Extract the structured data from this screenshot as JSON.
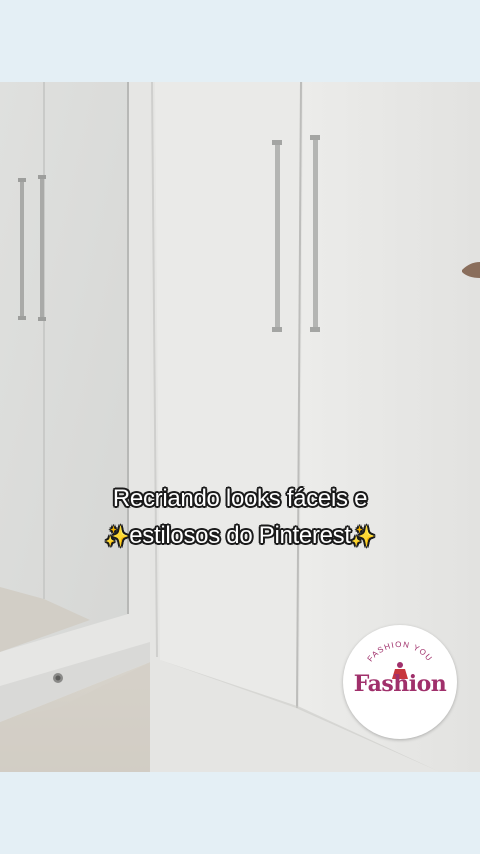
{
  "caption": {
    "line1": "Recriando looks fáceis e",
    "line2": "estilosos do Pinterest",
    "sparkle": "✨"
  },
  "watermark": {
    "brand": "Fashion",
    "ring_text": "FASHION YOU",
    "accent_color": "#a0306b"
  },
  "colors": {
    "frame_background": "#e4eff5",
    "caption_text": "#ffffff",
    "caption_outline": "#1b1b1b",
    "sparkle": "#f3d451"
  }
}
